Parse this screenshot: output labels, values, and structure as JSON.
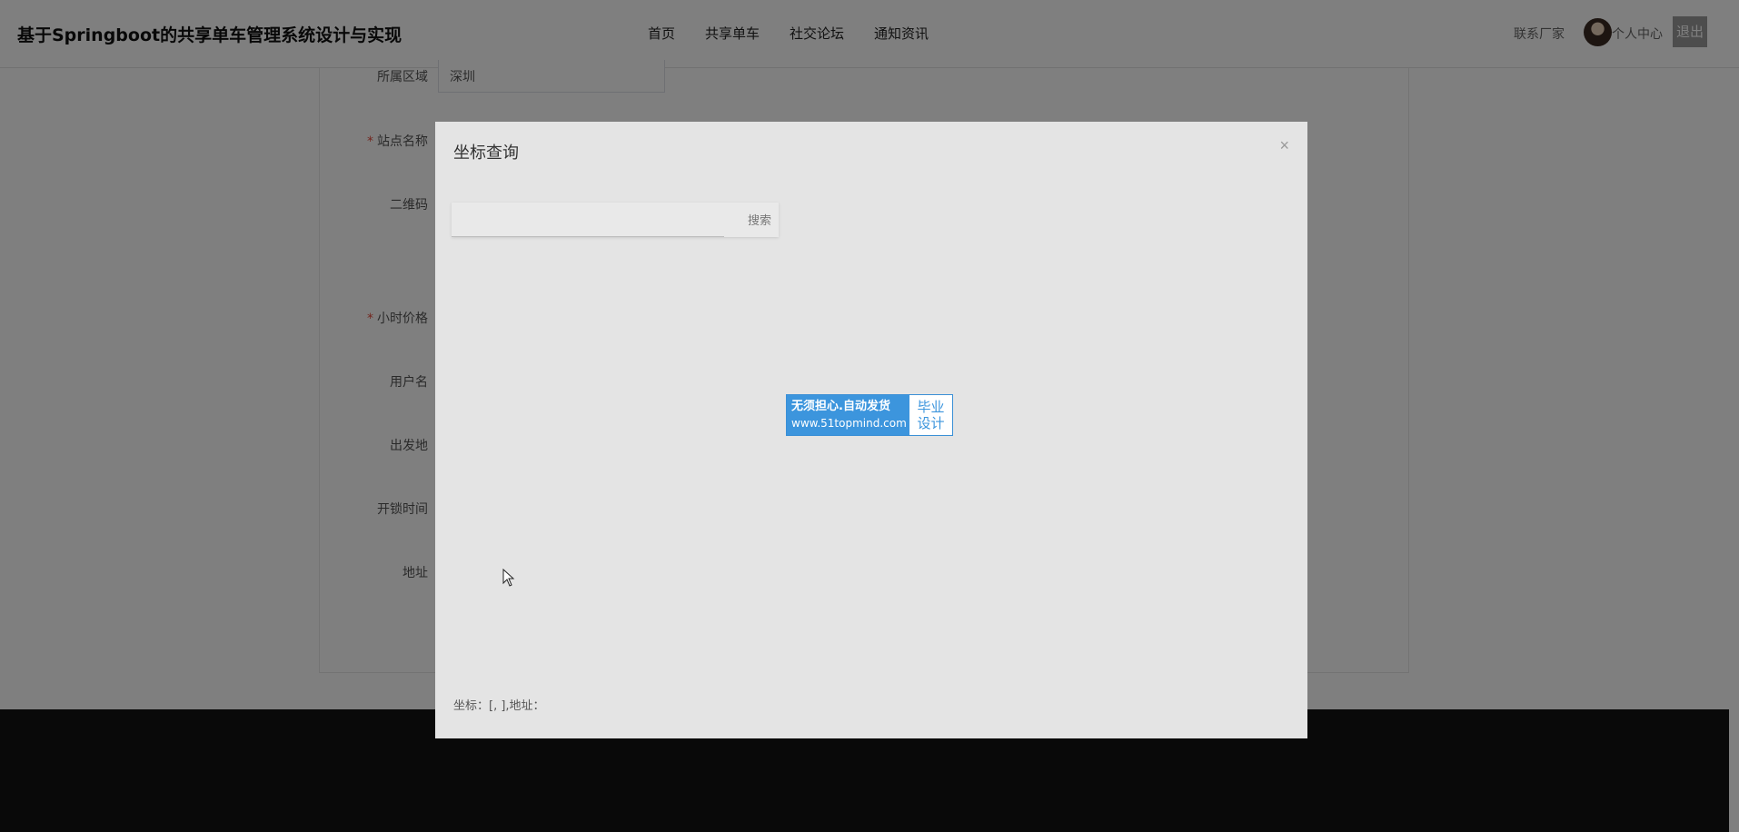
{
  "header": {
    "site_title": "基于Springboot的共享单车管理系统设计与实现",
    "nav": [
      "首页",
      "共享单车",
      "社交论坛",
      "通知资讯"
    ],
    "contact": "联系厂家",
    "personal_center": "个人中心",
    "logout": "退出"
  },
  "form": {
    "region_label": "所属区域",
    "region_value": "深圳",
    "station_label": "站点名称",
    "qrcode_label": "二维码",
    "price_label": "小时价格",
    "username_label": "用户名",
    "departure_label": "出发地",
    "unlock_time_label": "开锁时间",
    "address_label": "地址"
  },
  "modal": {
    "title": "坐标查询",
    "close": "×",
    "search_button": "搜索",
    "coord_text": "坐标：[, ],地址："
  },
  "watermark": {
    "line1": "无须担心.自动发货",
    "line2": "www.51topmind.com",
    "right1": "毕业",
    "right2": "设计"
  },
  "colors": {
    "overlay": "#000000",
    "modal_bg": "#e4e4e4",
    "watermark_blue": "#3c95dd",
    "required": "#e74c3c"
  }
}
